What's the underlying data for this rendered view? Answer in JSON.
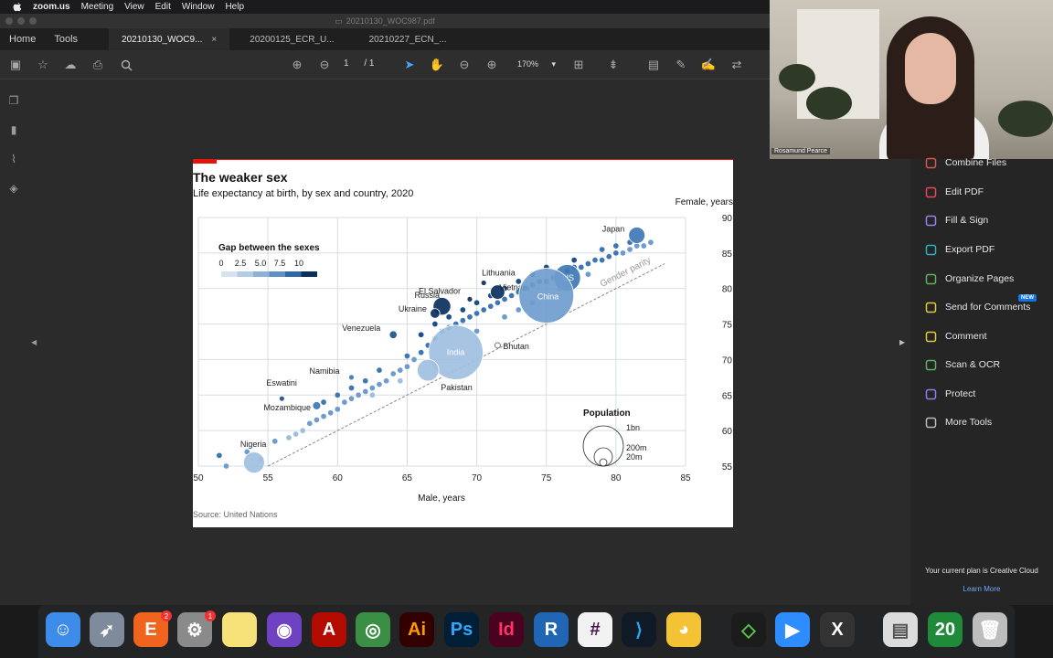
{
  "menubar": {
    "app": "zoom.us",
    "items": [
      "Meeting",
      "View",
      "Edit",
      "Window",
      "Help"
    ]
  },
  "window": {
    "title": "20210130_WOC987.pdf"
  },
  "nav": {
    "home": "Home",
    "tools": "Tools"
  },
  "tabs": [
    {
      "label": "20210130_WOC9...",
      "active": true,
      "close": "×"
    },
    {
      "label": "20200125_ECR_U...",
      "active": false
    },
    {
      "label": "20210227_ECN_...",
      "active": false
    }
  ],
  "toolbar": {
    "page_current": "1",
    "page_total": "/ 1",
    "zoom": "170%"
  },
  "chart_data": {
    "type": "scatter",
    "title": "The weaker sex",
    "subtitle": "Life expectancy at birth, by sex and country, 2020",
    "xlabel": "Male, years",
    "ylabel": "Female, years",
    "source": "Source: United Nations",
    "xlim": [
      50,
      85
    ],
    "ylim": [
      55,
      90
    ],
    "xticks": [
      50,
      55,
      60,
      65,
      70,
      75,
      80,
      85
    ],
    "yticks": [
      55,
      60,
      65,
      70,
      75,
      80,
      85,
      90
    ],
    "legend_gap": {
      "title": "Gap between the sexes",
      "ticks": [
        "0",
        "2.5",
        "5.0",
        "7.5",
        "10"
      ]
    },
    "legend_pop": {
      "title": "Population",
      "labels": [
        "1bn",
        "200m",
        "20m"
      ]
    },
    "parity_label": "Gender parity",
    "labeled_points": [
      {
        "name": "Japan",
        "x": 81.5,
        "y": 87.5,
        "gap": 6.0,
        "pop": 126
      },
      {
        "name": "Lithuania",
        "x": 70.5,
        "y": 80.8,
        "gap": 10,
        "pop": 3
      },
      {
        "name": "Vietnam",
        "x": 71.5,
        "y": 79.5,
        "gap": 9.5,
        "pop": 97
      },
      {
        "name": "El Salvador",
        "x": 69.5,
        "y": 78.5,
        "gap": 9.5,
        "pop": 6
      },
      {
        "name": "Russia",
        "x": 67.5,
        "y": 77.5,
        "gap": 10,
        "pop": 146
      },
      {
        "name": "US",
        "x": 76.5,
        "y": 81.5,
        "gap": 5,
        "pop": 331
      },
      {
        "name": "China",
        "x": 75,
        "y": 79,
        "gap": 4.5,
        "pop": 1400
      },
      {
        "name": "Ukraine",
        "x": 67,
        "y": 76.5,
        "gap": 9.5,
        "pop": 44
      },
      {
        "name": "Venezuela",
        "x": 64,
        "y": 73.5,
        "gap": 8,
        "pop": 28
      },
      {
        "name": "Bhutan",
        "x": 71.5,
        "y": 72.0,
        "gap": 0.5,
        "pop": 1
      },
      {
        "name": "India",
        "x": 68.5,
        "y": 71.0,
        "gap": 2.5,
        "pop": 1380
      },
      {
        "name": "Pakistan",
        "x": 66.5,
        "y": 68.5,
        "gap": 2,
        "pop": 220
      },
      {
        "name": "Namibia",
        "x": 61,
        "y": 67.5,
        "gap": 6,
        "pop": 2.5
      },
      {
        "name": "Eswatini",
        "x": 56,
        "y": 64.5,
        "gap": 8.5,
        "pop": 1.2
      },
      {
        "name": "Mozambique",
        "x": 58.5,
        "y": 63.5,
        "gap": 5.5,
        "pop": 31
      },
      {
        "name": "Nigeria",
        "x": 54,
        "y": 55.5,
        "gap": 1.5,
        "pop": 206
      }
    ],
    "other_points": [
      [
        51.5,
        56.5
      ],
      [
        52,
        55
      ],
      [
        53.5,
        57
      ],
      [
        54.5,
        56
      ],
      [
        55.5,
        58.5
      ],
      [
        56.5,
        59
      ],
      [
        57,
        59.5
      ],
      [
        57.5,
        60
      ],
      [
        58,
        61
      ],
      [
        58.5,
        61.5
      ],
      [
        59,
        62
      ],
      [
        59.5,
        62.5
      ],
      [
        60,
        63
      ],
      [
        60.5,
        64
      ],
      [
        61,
        64.5
      ],
      [
        61.5,
        65
      ],
      [
        62,
        65.5
      ],
      [
        62.5,
        66
      ],
      [
        63,
        66.5
      ],
      [
        63.5,
        67
      ],
      [
        64,
        68
      ],
      [
        64.5,
        68.5
      ],
      [
        65,
        69
      ],
      [
        65.5,
        70
      ],
      [
        66,
        71
      ],
      [
        66.5,
        72
      ],
      [
        67,
        73
      ],
      [
        67.5,
        74
      ],
      [
        68,
        74.5
      ],
      [
        68.5,
        75
      ],
      [
        69,
        75.5
      ],
      [
        69.5,
        76
      ],
      [
        70,
        76.5
      ],
      [
        70.5,
        77
      ],
      [
        71,
        77.5
      ],
      [
        71.5,
        78
      ],
      [
        72,
        78.5
      ],
      [
        72.5,
        79
      ],
      [
        73,
        79.5
      ],
      [
        73.5,
        80
      ],
      [
        74,
        80.5
      ],
      [
        74.5,
        81
      ],
      [
        75,
        81
      ],
      [
        75.5,
        81.5
      ],
      [
        76,
        82
      ],
      [
        76.5,
        82.5
      ],
      [
        77,
        83
      ],
      [
        77.5,
        83
      ],
      [
        78,
        83.5
      ],
      [
        78.5,
        84
      ],
      [
        79,
        84
      ],
      [
        79.5,
        84.5
      ],
      [
        80,
        85
      ],
      [
        80.5,
        85
      ],
      [
        81,
        85.5
      ],
      [
        81.5,
        86
      ],
      [
        82,
        86
      ],
      [
        82.5,
        86.5
      ],
      [
        59,
        64
      ],
      [
        60,
        65
      ],
      [
        61,
        66
      ],
      [
        62,
        67
      ],
      [
        63,
        68.5
      ],
      [
        65,
        70.5
      ],
      [
        66,
        73.5
      ],
      [
        67,
        75
      ],
      [
        68,
        76
      ],
      [
        69,
        77
      ],
      [
        70,
        78
      ],
      [
        71,
        79
      ],
      [
        72,
        80
      ],
      [
        73,
        81
      ],
      [
        74,
        82
      ],
      [
        75,
        83
      ],
      [
        77,
        84
      ],
      [
        79,
        85.5
      ],
      [
        80,
        86
      ],
      [
        81,
        86.5
      ],
      [
        62.5,
        65
      ],
      [
        64.5,
        67
      ],
      [
        70,
        74
      ],
      [
        72,
        76
      ],
      [
        73,
        77
      ],
      [
        74,
        78
      ],
      [
        76,
        80
      ],
      [
        78,
        82
      ]
    ]
  },
  "webcam": {
    "name": "Rosamund Pearce"
  },
  "tools_panel": {
    "items": [
      {
        "label": "Combine Files",
        "icon": "combine-icon",
        "color": "#d9534f"
      },
      {
        "label": "Edit PDF",
        "icon": "edit-pdf-icon",
        "color": "#e8465b"
      },
      {
        "label": "Fill & Sign",
        "icon": "fill-sign-icon",
        "color": "#9e7ff0"
      },
      {
        "label": "Export PDF",
        "icon": "export-icon",
        "color": "#27b3c4"
      },
      {
        "label": "Organize Pages",
        "icon": "organize-icon",
        "color": "#5fb15e"
      },
      {
        "label": "Send for Comments",
        "icon": "send-comments-icon",
        "color": "#e8c83f"
      },
      {
        "label": "Comment",
        "icon": "comment-icon",
        "color": "#e8c83f"
      },
      {
        "label": "Scan & OCR",
        "icon": "scan-icon",
        "color": "#5fb15e"
      },
      {
        "label": "Protect",
        "icon": "protect-icon",
        "color": "#8a7ff0"
      },
      {
        "label": "More Tools",
        "icon": "more-tools-icon",
        "color": "#bbbbbb"
      }
    ],
    "new_badge": "NEW",
    "plan_text": "Your current plan is Creative Cloud",
    "learn_more": "Learn More"
  },
  "dock": {
    "apps": [
      {
        "name": "Finder",
        "color": "#3d8ce9",
        "glyph": "☺"
      },
      {
        "name": "Launchpad",
        "color": "#7d8b9c",
        "glyph": "➶"
      },
      {
        "name": "Etsy",
        "color": "#f1641e",
        "glyph": "E",
        "badge": "2"
      },
      {
        "name": "System Preferences",
        "color": "#8a8a8a",
        "glyph": "⚙",
        "badge": "1"
      },
      {
        "name": "Notes",
        "color": "#f7e27a",
        "glyph": ""
      },
      {
        "name": "GitHub Desktop",
        "color": "#6f42c1",
        "glyph": "◉"
      },
      {
        "name": "Acrobat",
        "color": "#b30b00",
        "glyph": "A"
      },
      {
        "name": "Chrome",
        "color": "#3a8f44",
        "glyph": "◎"
      },
      {
        "name": "Illustrator",
        "color": "#330000",
        "glyph": "Ai",
        "fg": "#ff9a00"
      },
      {
        "name": "Photoshop",
        "color": "#001e36",
        "glyph": "Ps",
        "fg": "#31a8ff"
      },
      {
        "name": "InDesign",
        "color": "#49021f",
        "glyph": "Id",
        "fg": "#ff3366"
      },
      {
        "name": "R",
        "color": "#2166b5",
        "glyph": "R"
      },
      {
        "name": "Slack",
        "color": "#f2f2f2",
        "glyph": "#",
        "fg": "#4a154b"
      },
      {
        "name": "VS Code",
        "color": "#0f1a26",
        "glyph": "⟩",
        "fg": "#23a9f2"
      },
      {
        "name": "Cyberduck",
        "color": "#f3c235",
        "glyph": "◕"
      },
      {
        "name": "Kite",
        "color": "#1c1c1c",
        "glyph": "◇",
        "fg": "#56c94a"
      },
      {
        "name": "Zoom",
        "color": "#2d8cff",
        "glyph": "▶"
      },
      {
        "name": "XQuartz",
        "color": "#333333",
        "glyph": "X"
      },
      {
        "name": "Preview",
        "color": "#dcdcdc",
        "glyph": "▤",
        "fg": "#555"
      },
      {
        "name": "Calendar",
        "color": "#1f8a3a",
        "glyph": "20"
      },
      {
        "name": "Trash",
        "color": "#bdbdbd",
        "glyph": "🗑"
      }
    ]
  }
}
